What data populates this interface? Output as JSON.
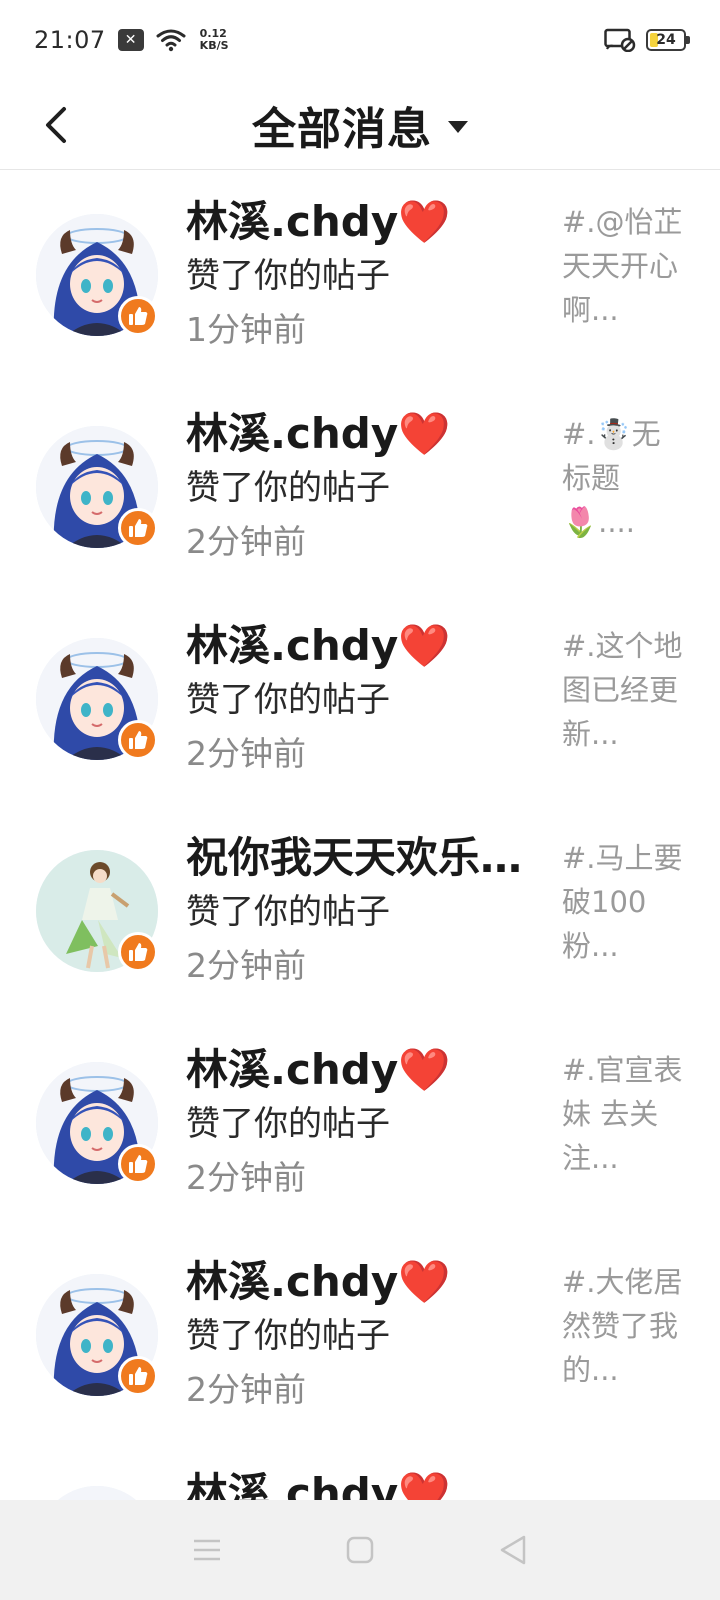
{
  "status_bar": {
    "time": "21:07",
    "net_speed_value": "0.12",
    "net_speed_unit": "KB/S",
    "battery_level": "24"
  },
  "header": {
    "title": "全部消息"
  },
  "messages": [
    {
      "user": "林溪.chdy❤️",
      "action": "赞了你的帖子",
      "time": "1分钟前",
      "preview": "#.@怡芷天天开心啊..."
    },
    {
      "user": "林溪.chdy❤️",
      "action": "赞了你的帖子",
      "time": "2分钟前",
      "preview": "#.☃️无标题🌷...."
    },
    {
      "user": "林溪.chdy❤️",
      "action": "赞了你的帖子",
      "time": "2分钟前",
      "preview": "#.这个地图已经更新..."
    },
    {
      "user": "祝你我天天欢乐...",
      "action": "赞了你的帖子",
      "time": "2分钟前",
      "preview": "#.马上要破100粉..."
    },
    {
      "user": "林溪.chdy❤️",
      "action": "赞了你的帖子",
      "time": "2分钟前",
      "preview": "#.官宣表妹 去关注..."
    },
    {
      "user": "林溪.chdy❤️",
      "action": "赞了你的帖子",
      "time": "2分钟前",
      "preview": "#.大佬居然赞了我的..."
    },
    {
      "user": "林溪.chdy❤️",
      "action": "",
      "time": "",
      "preview": ""
    }
  ]
}
